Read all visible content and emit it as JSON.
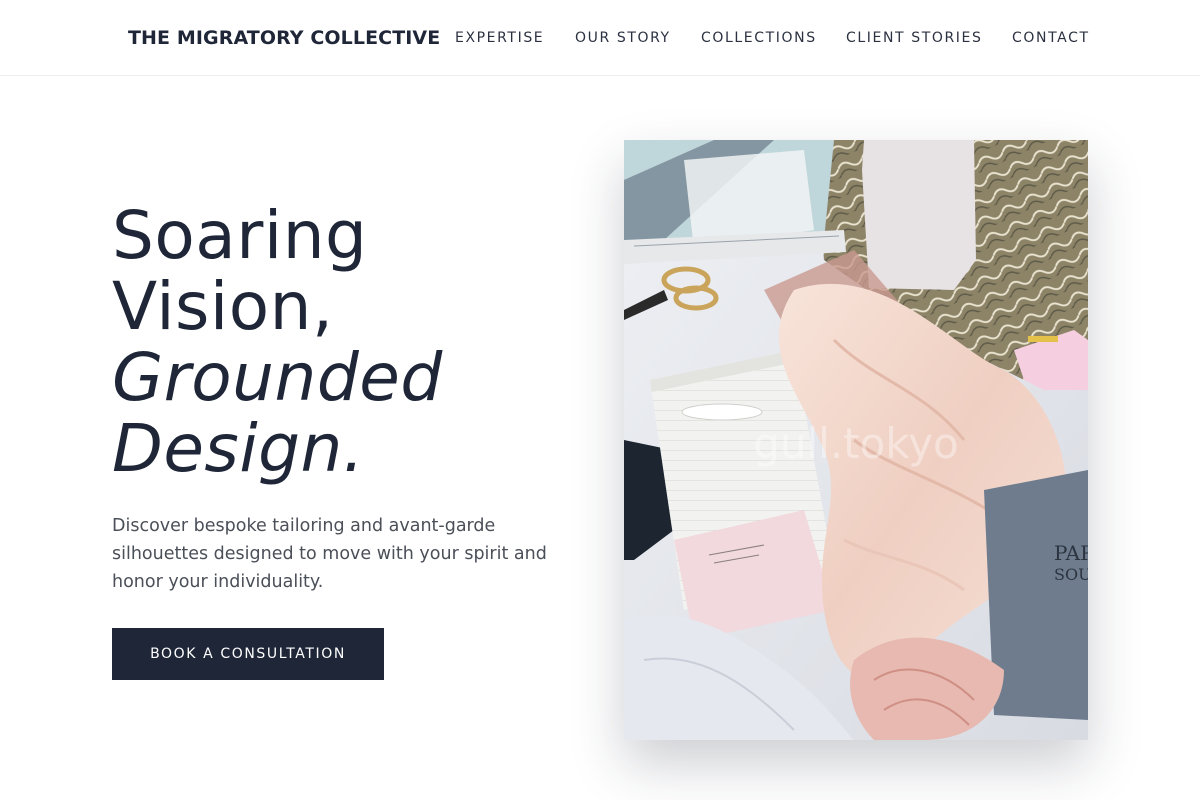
{
  "header": {
    "brand": "THE MIGRATORY COLLECTIVE",
    "nav": [
      {
        "label": "EXPERTISE"
      },
      {
        "label": "OUR STORY"
      },
      {
        "label": "COLLECTIONS"
      },
      {
        "label": "CLIENT STORIES"
      },
      {
        "label": "CONTACT"
      }
    ]
  },
  "hero": {
    "title_lines": [
      "Soaring",
      "Vision,",
      "Grounded",
      "Design."
    ],
    "subtitle": "Discover bespoke tailoring and avant-garde silhouettes designed to move with your spirit and honor your individuality.",
    "cta_label": "BOOK A CONSULTATION",
    "image": {
      "watermark": "gull.tokyo",
      "alt": "Flat-lay of fabrics, scissors, ruler, envelopes and a glue gun on a workbench"
    }
  },
  "colors": {
    "primary": "#1e2638",
    "text_body": "#4a4f58",
    "background": "#ffffff",
    "divider": "#eceef1"
  }
}
